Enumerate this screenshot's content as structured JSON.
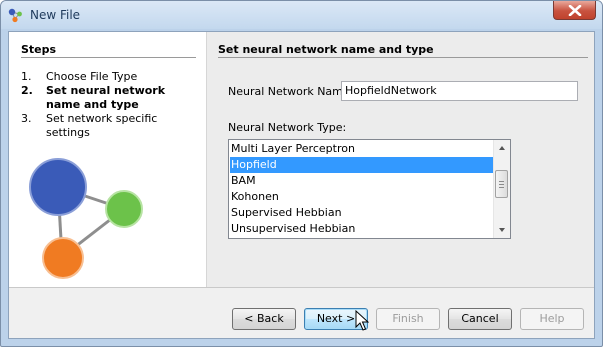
{
  "window": {
    "title": "New File"
  },
  "steps": {
    "title": "Steps",
    "items": [
      {
        "num": "1.",
        "label": "Choose File Type",
        "active": false
      },
      {
        "num": "2.",
        "label": "Set neural network name and type",
        "active": true
      },
      {
        "num": "3.",
        "label": "Set network specific settings",
        "active": false
      }
    ]
  },
  "main": {
    "title": "Set neural network name and type",
    "name_label": "Neural Network Name:",
    "name_value": "HopfieldNetwork",
    "type_label": "Neural Network Type:",
    "types": [
      "Multi Layer Perceptron",
      "Hopfield",
      "BAM",
      "Kohonen",
      "Supervised Hebbian",
      "Unsupervised Hebbian"
    ],
    "selected_type": "Hopfield"
  },
  "buttons": {
    "back": "< Back",
    "next": "Next >",
    "finish": "Finish",
    "cancel": "Cancel",
    "help": "Help"
  },
  "colors": {
    "selection": "#3399ff",
    "node_blue": "#3a5bb8",
    "node_green": "#6cc24a",
    "node_orange": "#f07b22"
  }
}
